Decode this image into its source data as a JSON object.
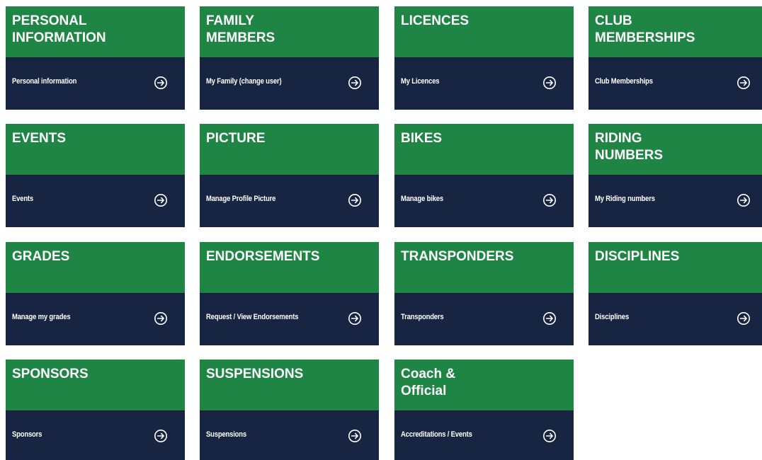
{
  "cards": [
    {
      "title": "PERSONAL\nINFORMATION",
      "link": "Personal information",
      "icon": "arrow-right-circle-icon"
    },
    {
      "title": "FAMILY\nMEMBERS",
      "link": "My Family (change user)",
      "icon": "arrow-right-circle-icon"
    },
    {
      "title": "LICENCES",
      "link": "My Licences",
      "icon": "arrow-right-circle-icon"
    },
    {
      "title": "CLUB\nMEMBERSHIPS",
      "link": "Club Memberships",
      "icon": "arrow-right-circle-icon"
    },
    {
      "title": "EVENTS",
      "link": "Events",
      "icon": "arrow-right-circle-icon"
    },
    {
      "title": "PICTURE",
      "link": "Manage Profile Picture",
      "icon": "arrow-right-circle-icon"
    },
    {
      "title": "BIKES",
      "link": "Manage bikes",
      "icon": "arrow-right-circle-icon"
    },
    {
      "title": "RIDING\nNUMBERS",
      "link": "My Riding numbers",
      "icon": "arrow-right-circle-icon"
    },
    {
      "title": "GRADES",
      "link": "Manage my grades",
      "icon": "arrow-right-circle-icon"
    },
    {
      "title": "ENDORSEMENTS",
      "link": "Request / View Endorsements",
      "icon": "arrow-right-circle-icon"
    },
    {
      "title": "TRANSPONDERS",
      "link": "Transponders",
      "icon": "arrow-right-circle-icon"
    },
    {
      "title": "DISCIPLINES",
      "link": "Disciplines",
      "icon": "arrow-right-circle-icon"
    },
    {
      "title": "SPONSORS",
      "link": "Sponsors",
      "icon": "arrow-right-circle-icon"
    },
    {
      "title": "SUSPENSIONS",
      "link": "Suspensions",
      "icon": "arrow-right-circle-icon"
    },
    {
      "title": "Coach &\nOfficial",
      "link": "Accreditations / Events",
      "icon": "arrow-right-circle-icon"
    }
  ],
  "colors": {
    "header_green": "#1f8545",
    "footer_navy": "#172542",
    "text": "#ffffff"
  }
}
